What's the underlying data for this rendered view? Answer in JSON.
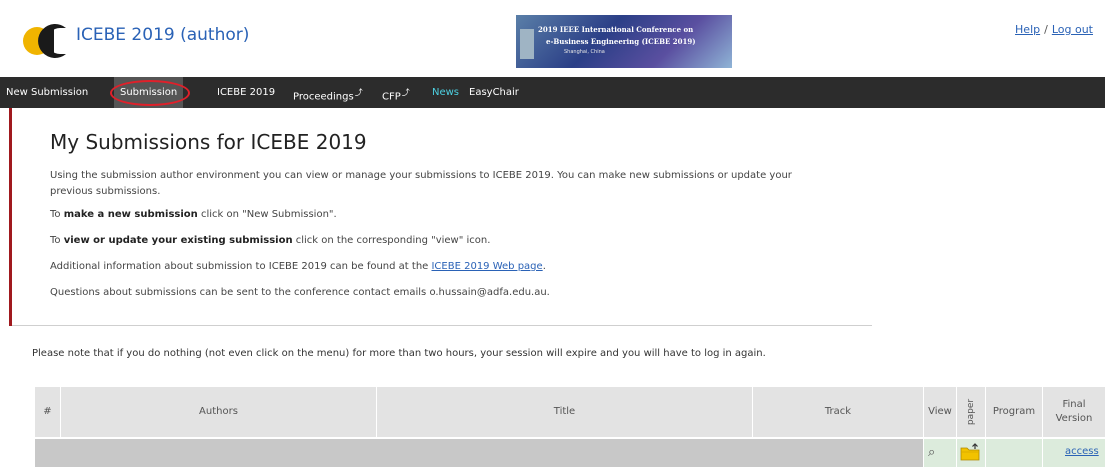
{
  "header": {
    "title": "ICEBE 2019 (author)",
    "banner": {
      "line1": "2019 IEEE International Conference on",
      "line2": "e-Business Engineering (ICEBE 2019)",
      "line3": "Shanghai, China"
    },
    "help": "Help",
    "separator": "/",
    "logout": "Log out"
  },
  "menu": [
    {
      "label": "New Submission"
    },
    {
      "label": "Submission"
    },
    {
      "label": "ICEBE 2019"
    },
    {
      "label": "Proceedings"
    },
    {
      "label": "CFP"
    },
    {
      "label": "News"
    },
    {
      "label": "EasyChair"
    }
  ],
  "content": {
    "title": "My Submissions for ICEBE 2019",
    "p1": "Using the submission author environment you can view or manage your submissions to ICEBE 2019. You can make new submissions or update your previous submissions.",
    "p2_pre": "To ",
    "p2_bold": "make a new submission",
    "p2_post": " click on \"New Submission\".",
    "p3_pre": "To ",
    "p3_bold": "view or update your existing submission",
    "p3_post": " click on the corresponding \"view\" icon.",
    "p4_pre": "Additional information about submission to ICEBE 2019 can be found at the ",
    "p4_link": "ICEBE 2019 Web page",
    "p4_post": ".",
    "p5": "Questions about submissions can be sent to the conference contact emails o.hussain@adfa.edu.au."
  },
  "note": "Please note that if you do nothing (not even click on the menu) for more than two hours, your session will expire and you will have to log in again.",
  "table": {
    "headers": {
      "num": "#",
      "authors": "Authors",
      "title": "Title",
      "track": "Track",
      "view": "View",
      "paper": "paper",
      "program": "Program",
      "final_version": "Final Version"
    },
    "row": {
      "access": "access"
    }
  },
  "icons": {
    "view": "magnifier-icon",
    "paper": "folder-upload-icon",
    "external": "external-link-icon"
  },
  "colors": {
    "menubar": "#2c2c2c",
    "accent_link": "#2a62b6",
    "news": "#4dd0e1",
    "annotation_circle": "#e0202a",
    "panel_bar": "#a0191e"
  }
}
